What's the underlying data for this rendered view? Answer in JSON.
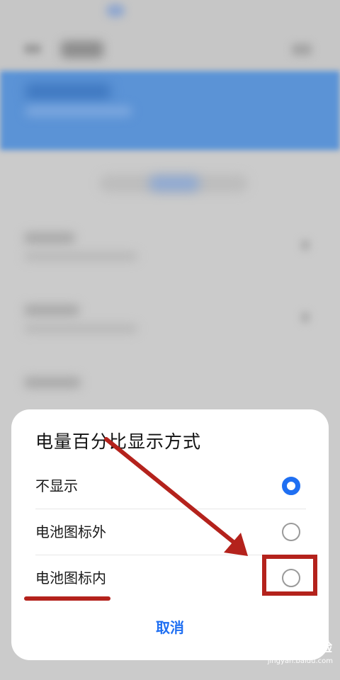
{
  "dialog": {
    "title": "电量百分比显示方式",
    "options": [
      {
        "label": "不显示",
        "selected": true
      },
      {
        "label": "电池图标外",
        "selected": false
      },
      {
        "label": "电池图标内",
        "selected": false
      }
    ],
    "cancel_label": "取消"
  },
  "watermark": {
    "logo": "Bai 经验",
    "url": "jingyan.baidu.com"
  },
  "colors": {
    "accent": "#1f6ff2",
    "annotation": "#b4221c",
    "banner": "#5b93d6"
  }
}
